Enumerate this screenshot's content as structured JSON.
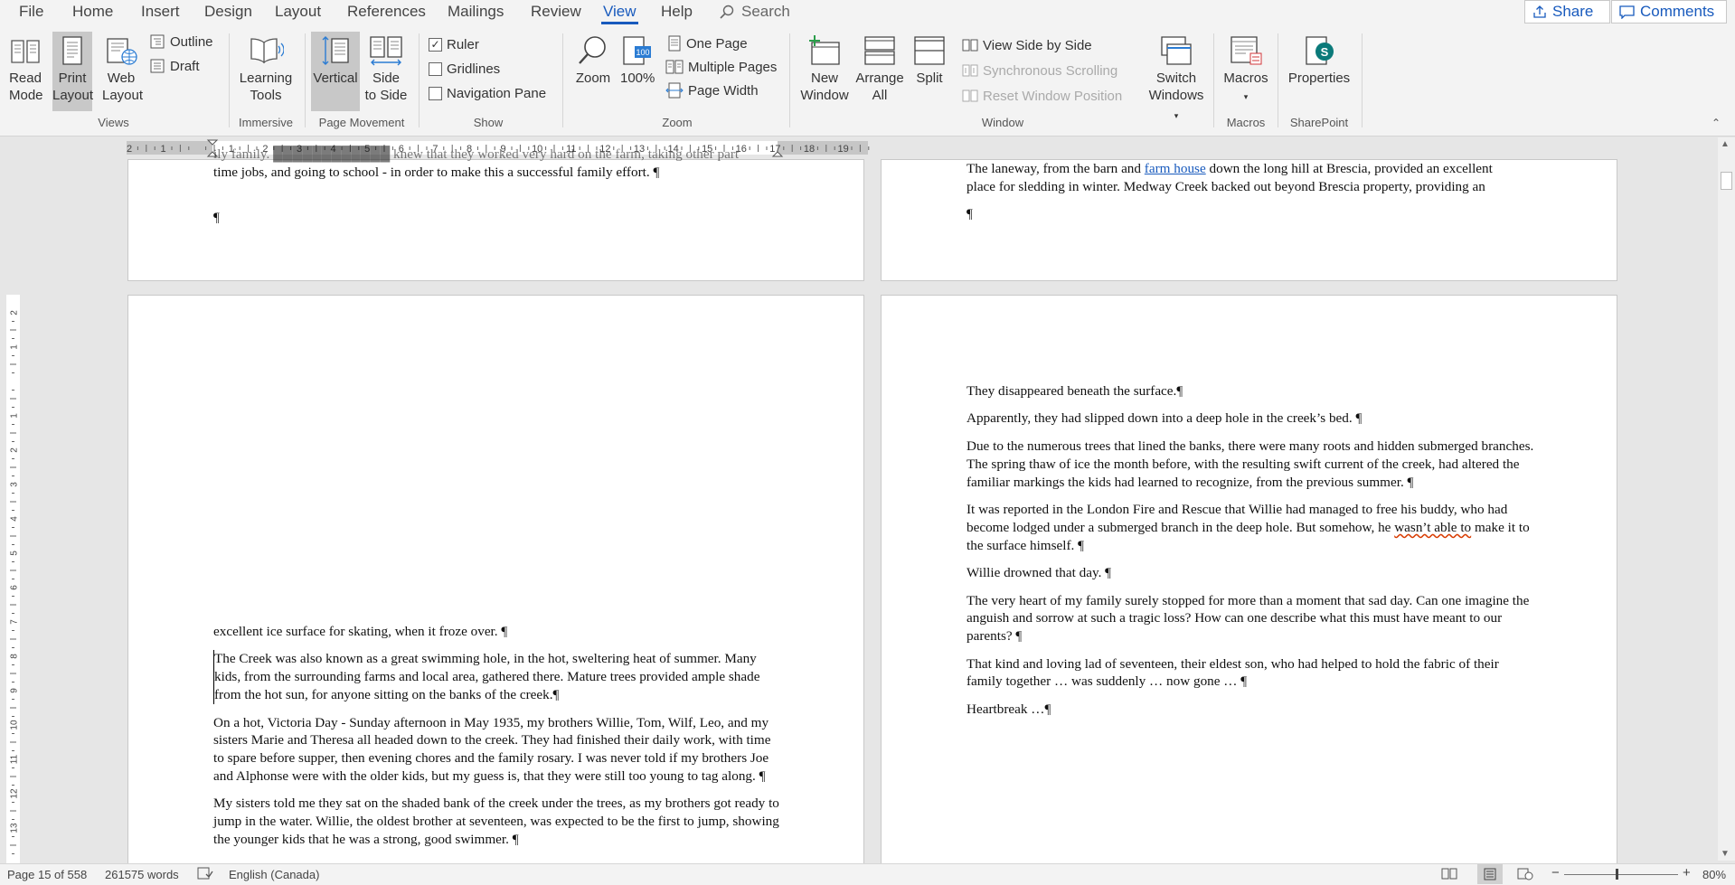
{
  "menu": {
    "tabs": [
      "File",
      "Home",
      "Insert",
      "Design",
      "Layout",
      "References",
      "Mailings",
      "Review",
      "View",
      "Help"
    ],
    "active_tab": "View",
    "search_label": "Search",
    "share_label": "Share",
    "comments_label": "Comments"
  },
  "ribbon": {
    "views": {
      "label": "Views",
      "read_mode": [
        "Read",
        "Mode"
      ],
      "print_layout": [
        "Print",
        "Layout"
      ],
      "web_layout": [
        "Web",
        "Layout"
      ],
      "outline": "Outline",
      "draft": "Draft"
    },
    "immersive": {
      "label": "Immersive",
      "learning_tools": [
        "Learning",
        "Tools"
      ]
    },
    "page_movement": {
      "label": "Page Movement",
      "vertical": "Vertical",
      "side_to_side": [
        "Side",
        "to Side"
      ]
    },
    "show": {
      "label": "Show",
      "ruler": "Ruler",
      "ruler_checked": true,
      "gridlines": "Gridlines",
      "gridlines_checked": false,
      "navigation_pane": "Navigation Pane",
      "navigation_pane_checked": false
    },
    "zoom": {
      "label": "Zoom",
      "zoom": "Zoom",
      "hundred": "100%",
      "one_page": "One Page",
      "multiple_pages": "Multiple Pages",
      "page_width": "Page Width"
    },
    "window": {
      "label": "Window",
      "new_window": [
        "New",
        "Window"
      ],
      "arrange_all": [
        "Arrange",
        "All"
      ],
      "split": "Split",
      "view_side_by_side": "View Side by Side",
      "synchronous_scrolling": "Synchronous Scrolling",
      "reset_window_position": "Reset Window Position",
      "switch_windows": [
        "Switch",
        "Windows"
      ]
    },
    "macros": {
      "label": "Macros",
      "macros": "Macros"
    },
    "sharepoint": {
      "label": "SharePoint",
      "properties": "Properties"
    }
  },
  "ruler": {
    "numbers": [
      "2",
      "1",
      "",
      "1",
      "2",
      "3",
      "4",
      "5",
      "6",
      "7",
      "8",
      "9",
      "10",
      "11",
      "12",
      "13",
      "14",
      "15",
      "16",
      "17",
      "18",
      "19"
    ],
    "v_numbers": [
      "2",
      "1",
      "",
      "1",
      "2",
      "3",
      "4",
      "5",
      "6",
      "7",
      "8",
      "9",
      "10",
      "11",
      "12",
      "13"
    ]
  },
  "pages": {
    "top_left": {
      "lines": [
        "ily family. ████████████ knew that they worked very hard on the farm, taking other part",
        "time jobs, and going to school - in order to make this a successful family effort. ¶",
        "¶"
      ]
    },
    "top_right": {
      "line1_pre": "The laneway, from the barn and ",
      "line1_link": "farm house",
      "line1_post": " down the long hill at Brescia, provided an excellent",
      "line2": "place for sledding in winter. Medway Creek backed out beyond Brescia property, providing an",
      "pilcrow": "¶"
    },
    "bottom_left": {
      "paragraphs": [
        "excellent ice surface for skating, when it froze over. ¶",
        "The Creek was also known as a great swimming hole, in the hot, sweltering heat of summer. Many kids, from the surrounding farms and local area, gathered there. Mature trees provided ample shade from the hot sun, for anyone sitting on the banks of the creek.¶",
        "On a hot, Victoria Day - Sunday afternoon in May 1935, my brothers Willie, Tom, Wilf, Leo, and my sisters Marie and Theresa all headed down to the creek. They had finished their daily work, with time to spare before supper, then evening chores and the family rosary. I was never told if my brothers Joe and Alphonse were with the older kids, but my guess is, that they were still too young to tag along. ¶",
        "My sisters told me they sat on the shaded bank of the creek under the trees, as my brothers got ready to jump in the water. Willie, the oldest brother at seventeen, was expected to be the first to jump, showing the younger kids that he was a strong, good swimmer. ¶"
      ]
    },
    "bottom_right": {
      "p1": "They disappeared beneath the surface.¶",
      "p2": "Apparently, they had slipped down into a deep hole in the creek’s bed. ¶",
      "p3": "Due to the numerous trees that lined the banks, there were many roots and hidden submerged branches. The spring thaw of ice the month before, with the resulting swift current of the creek, had altered the familiar markings the kids had learned to recognize, from the previous summer.  ¶",
      "p4_pre": "It was reported in the London Fire and Rescue that Willie had managed to free his buddy, who had become lodged under a submerged branch in the deep hole. But somehow, he ",
      "p4_squig": "wasn’t able to",
      "p4_post": " make it to the surface himself. ¶",
      "p5": "Willie drowned that day. ¶",
      "p6": "The very heart of my family surely stopped for more than a moment that sad day. Can one imagine the anguish and sorrow at such a tragic loss? How can one describe what this must have meant to our parents? ¶",
      "p7": "That kind and loving lad of seventeen, their eldest son, who had helped to hold the fabric of their family together … was suddenly … now gone … ¶",
      "p8": "Heartbreak …¶"
    }
  },
  "status": {
    "page": "Page 15 of 558",
    "words": "261575 words",
    "language": "English (Canada)",
    "zoom": "80%",
    "zoom_level": 0.8
  }
}
